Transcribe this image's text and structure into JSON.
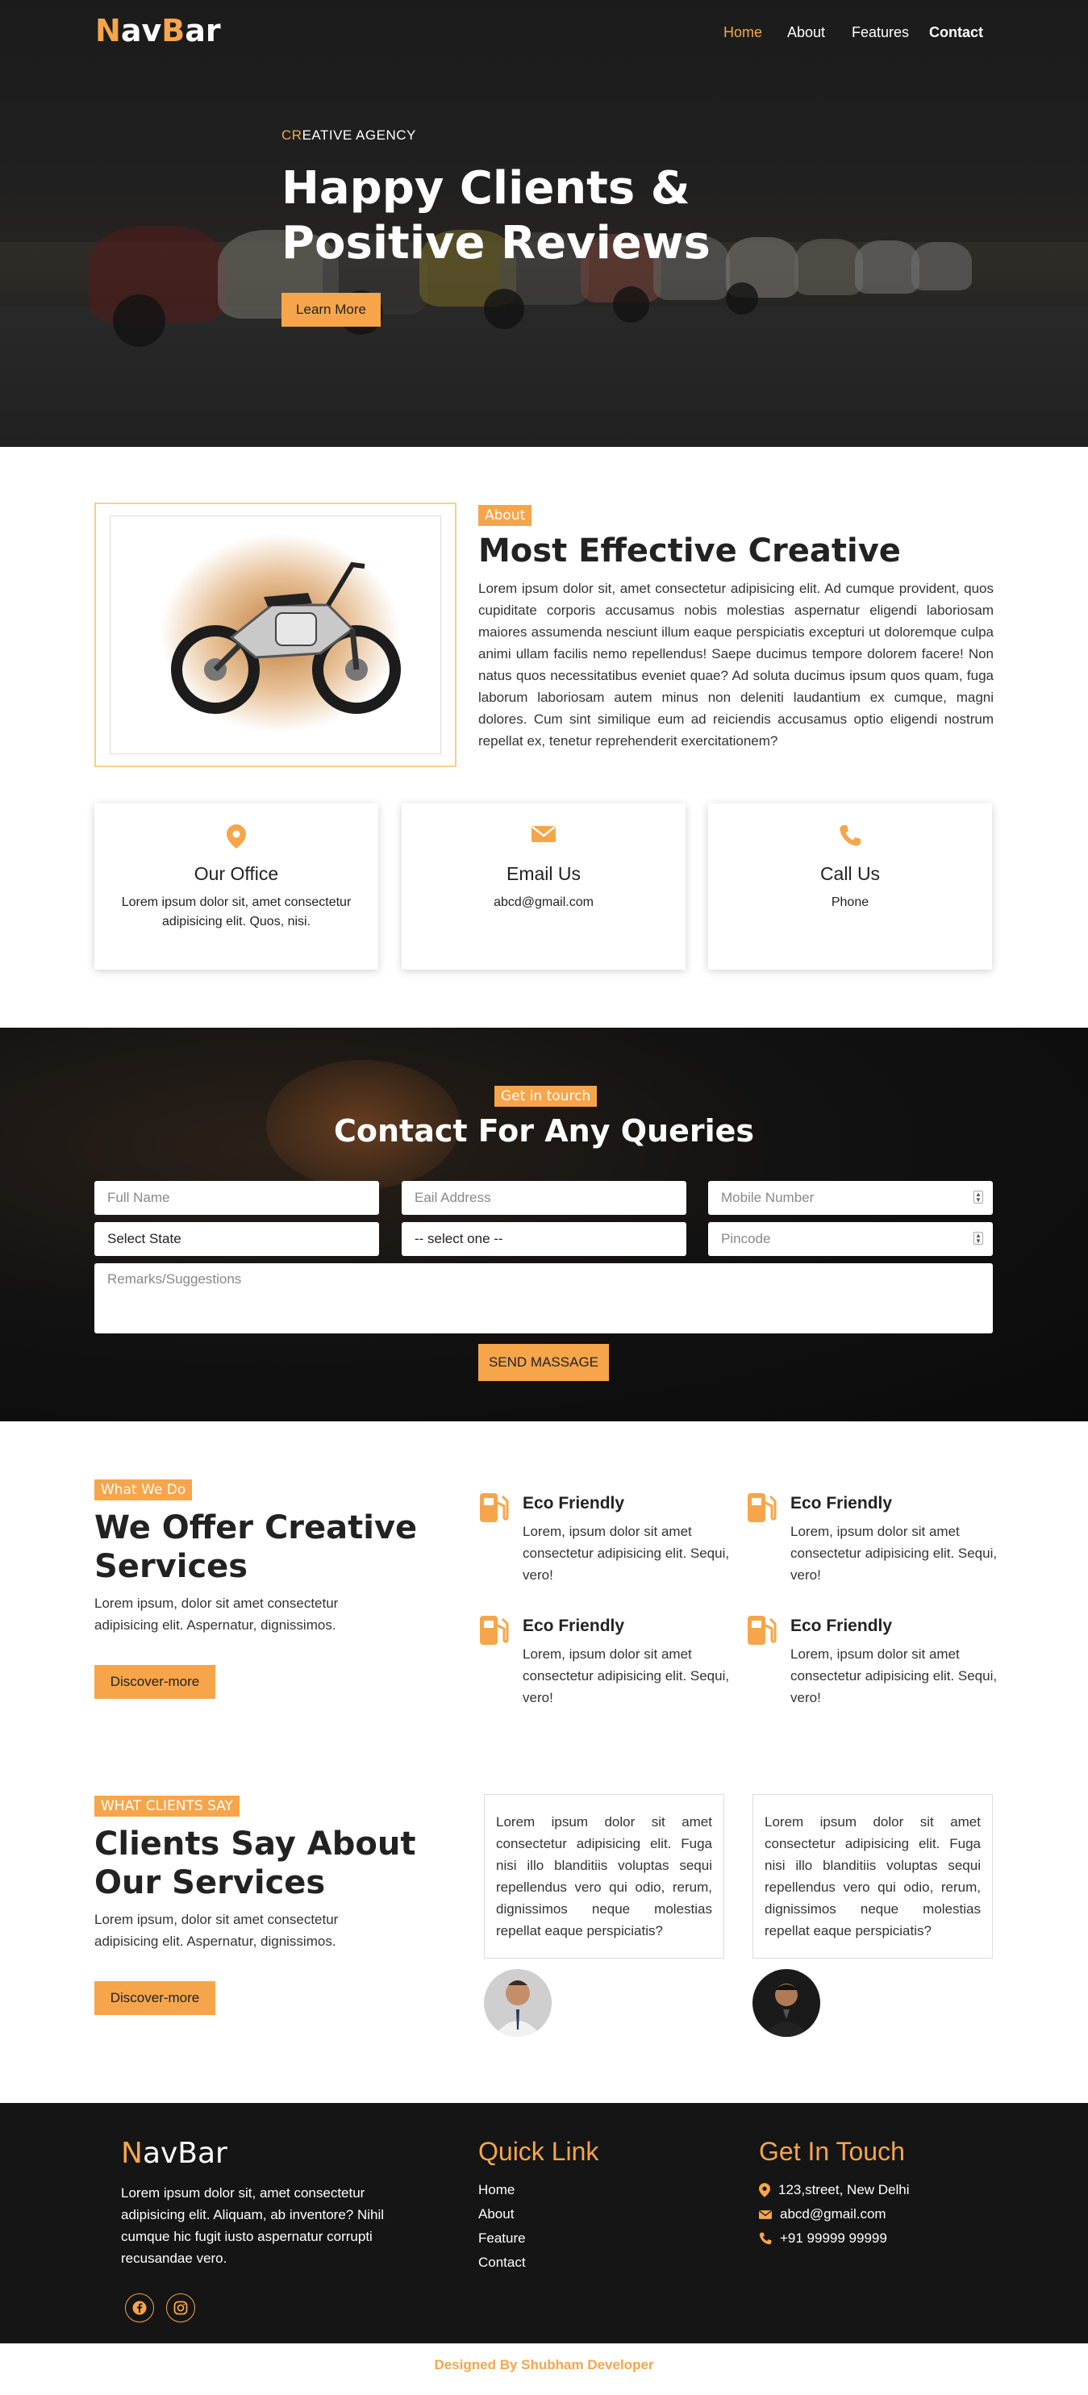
{
  "navbar": {
    "brand_initial_1": "N",
    "brand_rest_1": "av",
    "brand_initial_2": "B",
    "brand_rest_2": "ar",
    "links": [
      "Home",
      "About",
      "Features",
      "Contact"
    ]
  },
  "hero": {
    "subtitle_accent": "CR",
    "subtitle_rest": "EATIVE AGENCY",
    "title": "Happy Clients & Positive Reviews",
    "button": "Learn More"
  },
  "about": {
    "tag": "About",
    "title": "Most Effective Creative",
    "text": "Lorem ipsum dolor sit, amet consectetur adipisicing elit. Ad cumque provident, quos cupiditate corporis accusamus nobis molestias aspernatur eligendi laboriosam maiores assumenda nesciunt illum eaque perspiciatis excepturi ut doloremque culpa animi ullam facilis nemo repellendus! Saepe ducimus tempore dolorem facere! Non natus quos necessitatibus eveniet quae? Ad soluta ducimus ipsum quos quam, fuga laborum laboriosam autem minus non deleniti laudantium ex cumque, magni dolores. Cum sint similique eum ad reiciendis accusamus optio eligendi nostrum repellat ex, tenetur reprehenderit exercitationem?"
  },
  "cards": [
    {
      "icon": "location-pin-icon",
      "title": "Our Office",
      "detail": "Lorem ipsum dolor sit, amet consectetur adipisicing elit. Quos, nisi."
    },
    {
      "icon": "envelope-icon",
      "title": "Email Us",
      "detail": "abcd@gmail.com"
    },
    {
      "icon": "phone-icon",
      "title": "Call Us",
      "detail": "Phone"
    }
  ],
  "contact": {
    "tag": "Get in tourch",
    "title": "Contact For Any Queries",
    "fields": {
      "full_name": "Full Name",
      "email": "Eail Address",
      "mobile": "Mobile Number",
      "state": "Select State",
      "select_one": "-- select one --",
      "pincode": "Pincode",
      "remarks": "Remarks/Suggestions"
    },
    "button": "SEND MASSAGE"
  },
  "services": {
    "tag": "What We Do",
    "title": "We Offer Creative Services",
    "text": "Lorem ipsum, dolor sit amet consectetur adipisicing elit. Aspernatur, dignissimos.",
    "button": "Discover-more",
    "items": [
      {
        "title": "Eco Friendly",
        "text": "Lorem, ipsum dolor sit amet consectetur adipisicing elit. Sequi, vero!"
      },
      {
        "title": "Eco Friendly",
        "text": "Lorem, ipsum dolor sit amet consectetur adipisicing elit. Sequi, vero!"
      },
      {
        "title": "Eco Friendly",
        "text": "Lorem, ipsum dolor sit amet consectetur adipisicing elit. Sequi, vero!"
      },
      {
        "title": "Eco Friendly",
        "text": "Lorem, ipsum dolor sit amet consectetur adipisicing elit. Sequi, vero!"
      }
    ]
  },
  "testimonials": {
    "tag": "WHAT CLIENTS SAY",
    "title": "Clients Say About Our Services",
    "text": "Lorem ipsum, dolor sit amet consectetur adipisicing elit. Aspernatur, dignissimos.",
    "button": "Discover-more",
    "reviews": [
      "Lorem ipsum dolor sit amet consectetur adipisicing elit. Fuga nisi illo blanditiis voluptas sequi repellendus vero qui odio, rerum, dignissimos neque molestias repellat eaque perspiciatis?",
      "Lorem ipsum dolor sit amet consectetur adipisicing elit. Fuga nisi illo blanditiis voluptas sequi repellendus vero qui odio, rerum, dignissimos neque molestias repellat eaque perspiciatis?"
    ]
  },
  "footer": {
    "brand_initial": "N",
    "brand_rest": "avBar",
    "text": "Lorem ipsum dolor sit, amet consectetur adipisicing elit. Aliquam, ab inventore? Nihil cumque hic fugit iusto aspernatur corrupti recusandae vero.",
    "quick_title": "Quick Link",
    "quick_links": [
      "Home",
      "About",
      "Feature",
      "Contact"
    ],
    "touch_title": "Get In Touch",
    "address": "123,street, New Delhi",
    "email": "abcd@gmail.com",
    "phone": "+91 99999 99999",
    "social": [
      "facebook-icon",
      "instagram-icon"
    ]
  },
  "credit": "Designed By Shubham Developer",
  "colors": {
    "accent": "#f7a54a",
    "dark": "#151515"
  }
}
